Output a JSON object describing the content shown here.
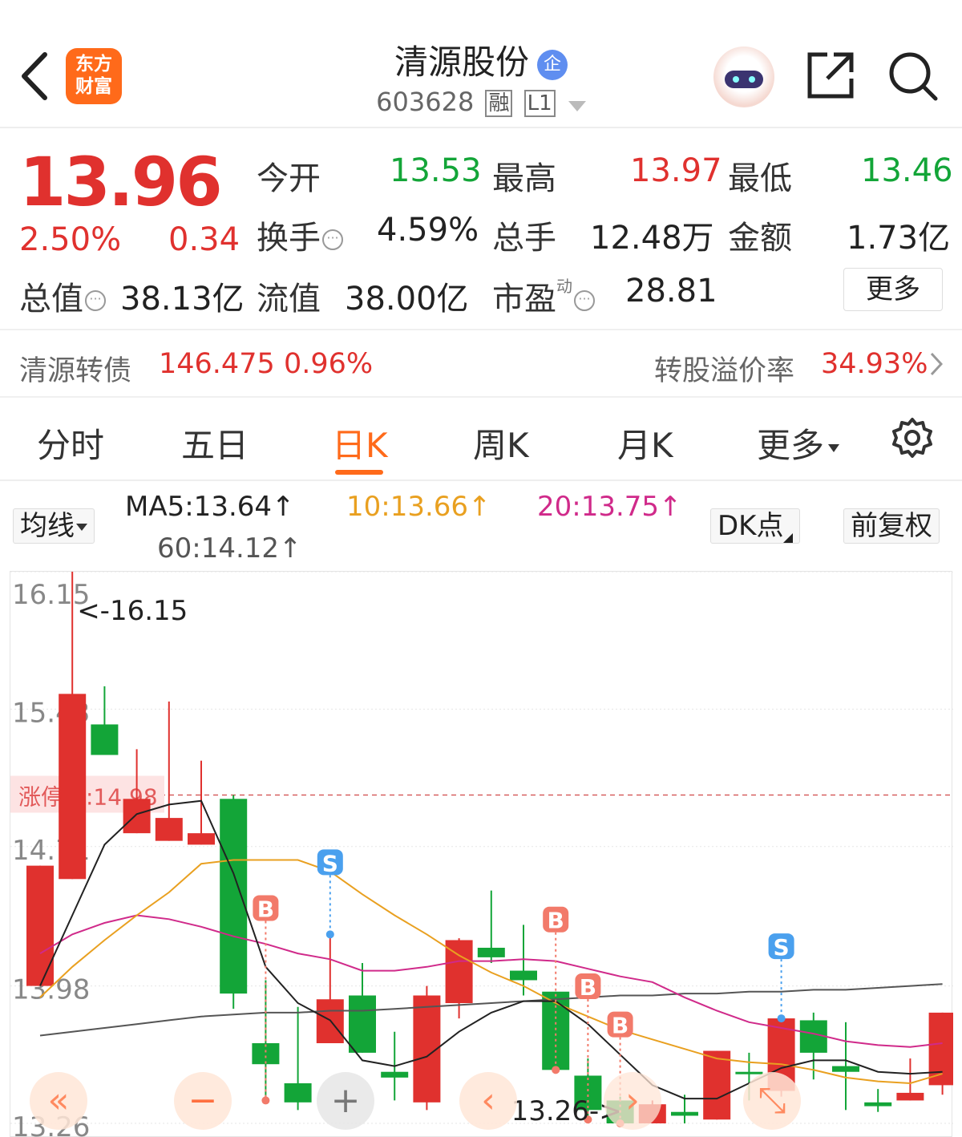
{
  "header": {
    "logo_line1": "东方",
    "logo_line2": "财富",
    "stock_name": "清源股份",
    "badge": "企",
    "stock_code": "603628",
    "tag1": "融",
    "tag2": "L1"
  },
  "quote": {
    "price": "13.96",
    "change_pct": "2.50%",
    "change": "0.34",
    "open_label": "今开",
    "open": "13.53",
    "high_label": "最高",
    "high": "13.97",
    "low_label": "最低",
    "low": "13.46",
    "turnover_label": "换手",
    "turnover": "4.59%",
    "volume_label": "总手",
    "volume": "12.48万",
    "amount_label": "金额",
    "amount": "1.73亿",
    "mktcap_label": "总值",
    "mktcap": "38.13亿",
    "float_label": "流值",
    "float_cap": "38.00亿",
    "pe_label": "市盈",
    "pe_sup": "动",
    "pe": "28.81",
    "more": "更多"
  },
  "bond": {
    "name": "清源转债",
    "price": "146.475",
    "pct": "0.96%",
    "premium_label": "转股溢价率",
    "premium": "34.93%"
  },
  "tabs": [
    "分时",
    "五日",
    "日K",
    "周K",
    "月K",
    "更多"
  ],
  "active_tab": "日K",
  "ma": {
    "selector": "均线",
    "ma5": "MA5:13.64↑",
    "ma10": "10:13.66↑",
    "ma20": "20:13.75↑",
    "ma60": "60:14.12↑",
    "dk": "DK点",
    "adjust": "前复权"
  },
  "colors": {
    "up": "#e0312e",
    "down": "#13a538",
    "ma5": "#222222",
    "ma10": "#e9a020",
    "ma20": "#d02a8a",
    "ma60": "#555555",
    "accent": "#ff6a1a"
  },
  "chart_data": {
    "type": "candlestick",
    "axis_labels": [
      "16.15",
      "15.43",
      "14.71",
      "13.98",
      "13.26"
    ],
    "ylim": [
      13.26,
      16.15
    ],
    "max_label": "<-16.15",
    "min_label": "13.26->",
    "limit_up_label": "涨停价:14.98",
    "limit_up": 14.98,
    "candles": [
      {
        "o": 13.98,
        "c": 14.61,
        "h": 14.61,
        "l": 13.98
      },
      {
        "o": 14.54,
        "c": 15.51,
        "h": 16.15,
        "l": 14.54
      },
      {
        "o": 15.35,
        "c": 15.19,
        "h": 15.55,
        "l": 15.19
      },
      {
        "o": 14.78,
        "c": 14.96,
        "h": 15.22,
        "l": 14.78
      },
      {
        "o": 14.74,
        "c": 14.86,
        "h": 15.47,
        "l": 14.74
      },
      {
        "o": 14.72,
        "c": 14.78,
        "h": 15.16,
        "l": 14.72
      },
      {
        "o": 14.96,
        "c": 13.94,
        "h": 14.98,
        "l": 13.86
      },
      {
        "o": 13.68,
        "c": 13.57,
        "h": 14.01,
        "l": 13.38
      },
      {
        "o": 13.47,
        "c": 13.37,
        "h": 13.87,
        "l": 13.33
      },
      {
        "o": 13.68,
        "c": 13.91,
        "h": 14.25,
        "l": 13.68
      },
      {
        "o": 13.93,
        "c": 13.63,
        "h": 14.1,
        "l": 13.63
      },
      {
        "o": 13.53,
        "c": 13.5,
        "h": 13.74,
        "l": 13.38
      },
      {
        "o": 13.37,
        "c": 13.93,
        "h": 13.98,
        "l": 13.33
      },
      {
        "o": 13.89,
        "c": 14.22,
        "h": 14.23,
        "l": 13.81
      },
      {
        "o": 14.18,
        "c": 14.13,
        "h": 14.48,
        "l": 14.1
      },
      {
        "o": 14.06,
        "c": 14.01,
        "h": 14.3,
        "l": 13.93
      },
      {
        "o": 13.95,
        "c": 13.54,
        "h": 13.95,
        "l": 13.54
      },
      {
        "o": 13.51,
        "c": 13.33,
        "h": 13.6,
        "l": 13.28
      },
      {
        "o": 13.38,
        "c": 13.26,
        "h": 13.4,
        "l": 13.26
      },
      {
        "o": 13.26,
        "c": 13.36,
        "h": 13.38,
        "l": 13.26
      },
      {
        "o": 13.32,
        "c": 13.3,
        "h": 13.41,
        "l": 13.26
      },
      {
        "o": 13.28,
        "c": 13.64,
        "h": 13.64,
        "l": 13.28
      },
      {
        "o": 13.53,
        "c": 13.52,
        "h": 13.63,
        "l": 13.38
      },
      {
        "o": 13.43,
        "c": 13.81,
        "h": 13.81,
        "l": 13.4
      },
      {
        "o": 13.8,
        "c": 13.63,
        "h": 13.84,
        "l": 13.49
      },
      {
        "o": 13.56,
        "c": 13.53,
        "h": 13.79,
        "l": 13.33
      },
      {
        "o": 13.37,
        "c": 13.35,
        "h": 13.44,
        "l": 13.32
      },
      {
        "o": 13.38,
        "c": 13.42,
        "h": 13.6,
        "l": 13.38
      },
      {
        "o": 13.46,
        "c": 13.84,
        "h": 13.84,
        "l": 13.41
      }
    ],
    "ma5": [
      13.98,
      14.35,
      14.72,
      14.88,
      14.93,
      14.95,
      14.57,
      14.08,
      13.89,
      13.8,
      13.59,
      13.56,
      13.61,
      13.74,
      13.84,
      13.9,
      13.9,
      13.78,
      13.62,
      13.46,
      13.39,
      13.39,
      13.47,
      13.55,
      13.59,
      13.59,
      13.53,
      13.52,
      13.53
    ],
    "ma10": [
      13.92,
      14.08,
      14.22,
      14.35,
      14.47,
      14.62,
      14.64,
      14.64,
      14.64,
      14.58,
      14.46,
      14.35,
      14.25,
      14.14,
      14.05,
      13.98,
      13.89,
      13.82,
      13.75,
      13.7,
      13.65,
      13.6,
      13.58,
      13.57,
      13.54,
      13.5,
      13.48,
      13.47,
      13.52
    ],
    "ma20": [
      14.15,
      14.25,
      14.31,
      14.35,
      14.33,
      14.29,
      14.24,
      14.2,
      14.15,
      14.12,
      14.06,
      14.06,
      14.08,
      14.11,
      14.11,
      14.12,
      14.11,
      14.07,
      14.03,
      14.0,
      13.92,
      13.85,
      13.79,
      13.76,
      13.73,
      13.69,
      13.67,
      13.66,
      13.68
    ],
    "ma60": [
      13.72,
      13.74,
      13.76,
      13.78,
      13.8,
      13.82,
      13.83,
      13.84,
      13.84,
      13.85,
      13.85,
      13.86,
      13.87,
      13.88,
      13.89,
      13.9,
      13.91,
      13.92,
      13.93,
      13.93,
      13.94,
      13.94,
      13.95,
      13.95,
      13.96,
      13.96,
      13.97,
      13.98,
      13.99
    ],
    "signals": [
      {
        "i": 7,
        "type": "B"
      },
      {
        "i": 9,
        "type": "S"
      },
      {
        "i": 16,
        "type": "B"
      },
      {
        "i": 17,
        "type": "B"
      },
      {
        "i": 18,
        "type": "B"
      },
      {
        "i": 23,
        "type": "S"
      }
    ]
  }
}
